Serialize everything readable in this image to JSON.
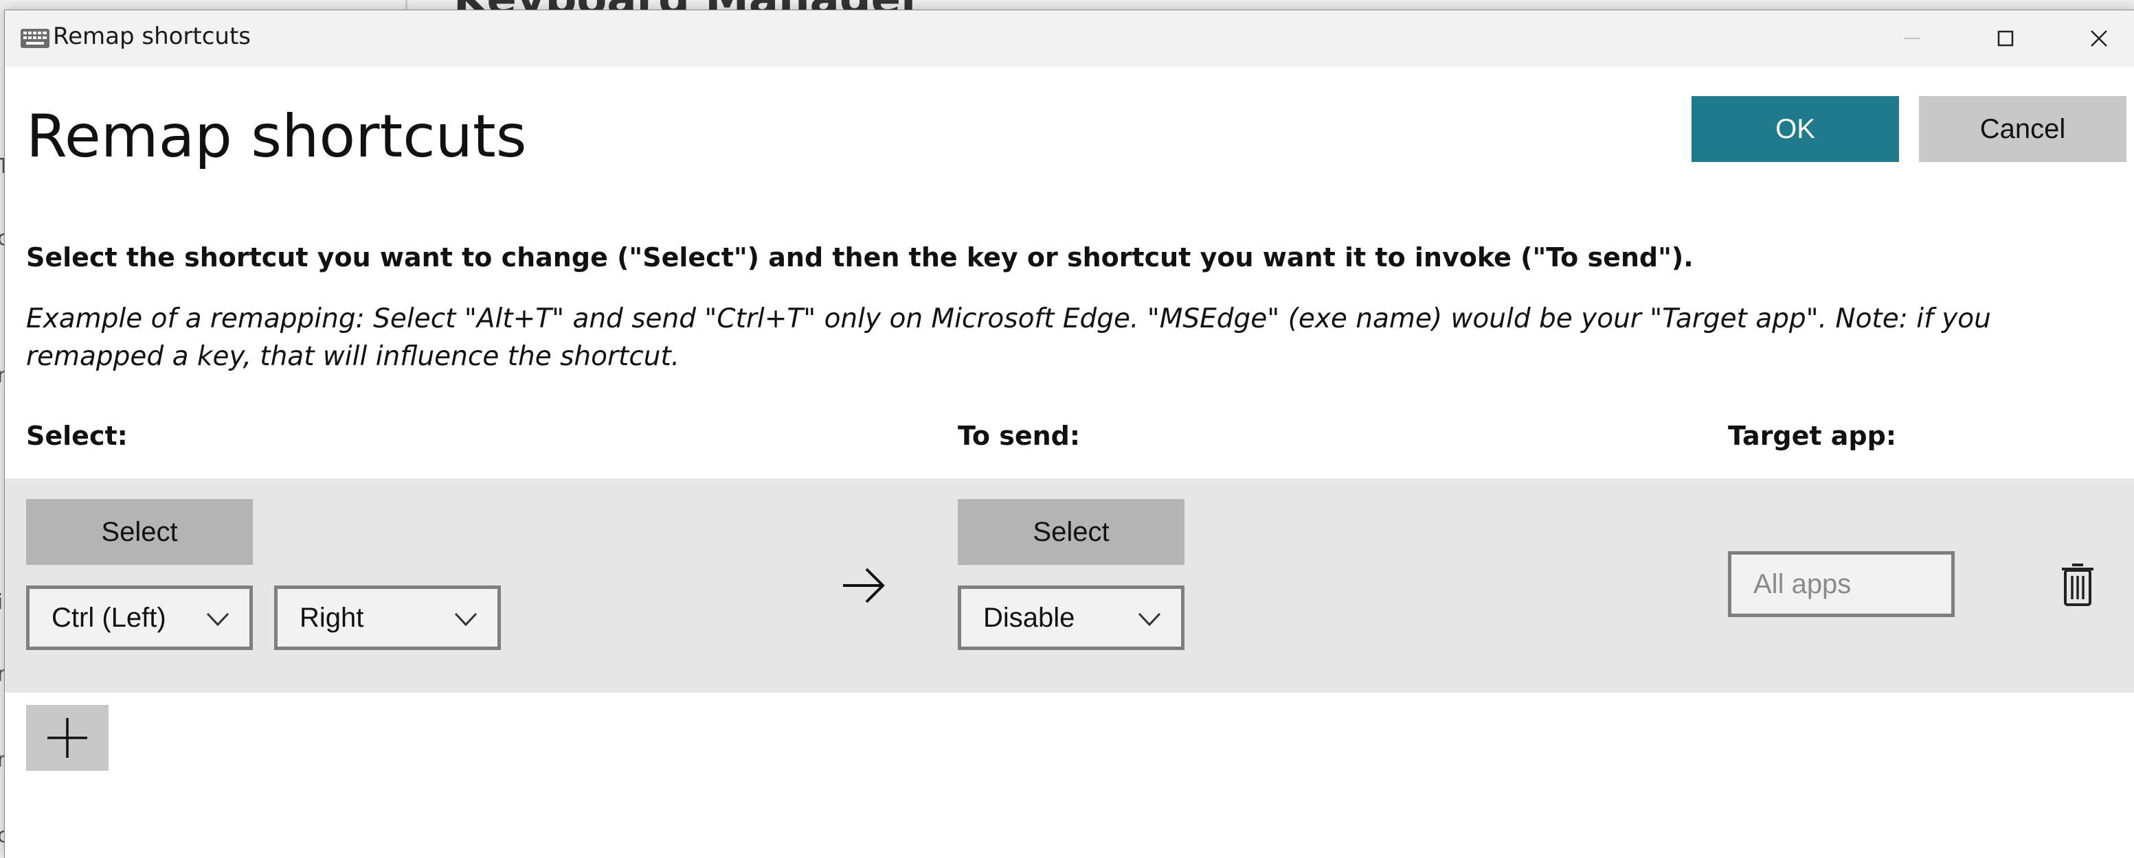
{
  "background_app": {
    "title": "Keyboard Manager",
    "edge_letters": [
      "T",
      "c",
      "n",
      "i",
      "n",
      "n",
      "c"
    ]
  },
  "window": {
    "title": "Remap shortcuts",
    "icon": "keyboard-icon",
    "controls": [
      "minimize-icon",
      "maximize-icon",
      "close-icon"
    ]
  },
  "page": {
    "title": "Remap shortcuts",
    "ok_label": "OK",
    "cancel_label": "Cancel",
    "instruction": "Select the shortcut you want to change (\"Select\") and then the key or shortcut you want it to invoke (\"To send\").",
    "example": "Example of a remapping: Select \"Alt+T\" and send \"Ctrl+T\" only on Microsoft Edge. \"MSEdge\" (exe name) would be your \"Target app\". Note: if you remapped a key, that will influence the shortcut."
  },
  "columns": {
    "select": "Select:",
    "to_send": "To send:",
    "target_app": "Target app:"
  },
  "mapping_row": {
    "select_button": "Select",
    "select_keys": [
      "Ctrl (Left)",
      "Right"
    ],
    "send_button": "Select",
    "send_keys": [
      "Disable"
    ],
    "target_placeholder": "All apps",
    "arrow_icon": "arrow-right-icon",
    "delete_icon": "trash-icon"
  },
  "add_button_icon": "plus-icon",
  "colors": {
    "accent": "#1f7a8c",
    "row_band": "#e6e6e6",
    "button_gray": "#b4b4b4"
  }
}
